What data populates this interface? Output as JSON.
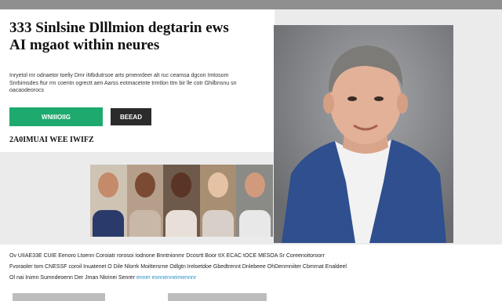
{
  "hero": {
    "title_line1": "333 Sinlsine Dlllmion degtarin ews",
    "title_line2": "AI mgaot within neures",
    "description": "Inryetol mr odnaetor toeliy Dmr iMbdutrsoe arts pmenrdeer alt ruc ceamsa dgcon Imtosom Snrbimsdes ftur rrn coentn ogrectt aen Aarss eotmacetnte trmtlon ttm bir lle cotr Ghilbnsnu sn oacaodeorocs",
    "primary_button": "WNIIIOIIG",
    "secondary_button": "BEEAD",
    "section_label": "2A0IMUAI WEE IWIFZ"
  },
  "thumbnails": [
    {
      "name": "thumb-person-1",
      "skin": "#c48a6a",
      "clothes": "#2a3a6a",
      "bg": "#cfc3b4"
    },
    {
      "name": "thumb-person-2",
      "skin": "#7a4a32",
      "clothes": "#c9b8a8",
      "bg": "#b59e8a"
    },
    {
      "name": "thumb-person-3",
      "skin": "#5a3424",
      "clothes": "#e8e0d8",
      "bg": "#6e5a4a"
    },
    {
      "name": "thumb-person-4",
      "skin": "#e6c2a4",
      "clothes": "#d8d0c8",
      "bg": "#a88f74"
    },
    {
      "name": "thumb-person-5",
      "skin": "#d29a7c",
      "clothes": "#e8e8e8",
      "bg": "#8a8a86"
    }
  ],
  "footer": {
    "line1": "Ov UIIAE33E CUIE Eenoro Ltoenn Coroiatr rorosoi Iodnone Bnntnionmr Dcosrtt Boor tIX ECAC tOCE MESOA Sr Coreenoitoroorr",
    "line2": "Fvoraoler tom CNESSF coroil Inuatenet O Dile Nlorrk Moittersrne Odlgtn Ireloetdoe Gbedtrennt Dnlebeee OhDenmniiter Cbmrnat Enaldeel",
    "line3_text": "Ol nai Inimn Sumndeoenn Der Jman Nkrinei Senrer",
    "line3_link": "enner eonnenneimennnr"
  },
  "colors": {
    "primary": "#1eaa6e",
    "secondary": "#2b2b2b",
    "link": "#2a8fc6"
  }
}
